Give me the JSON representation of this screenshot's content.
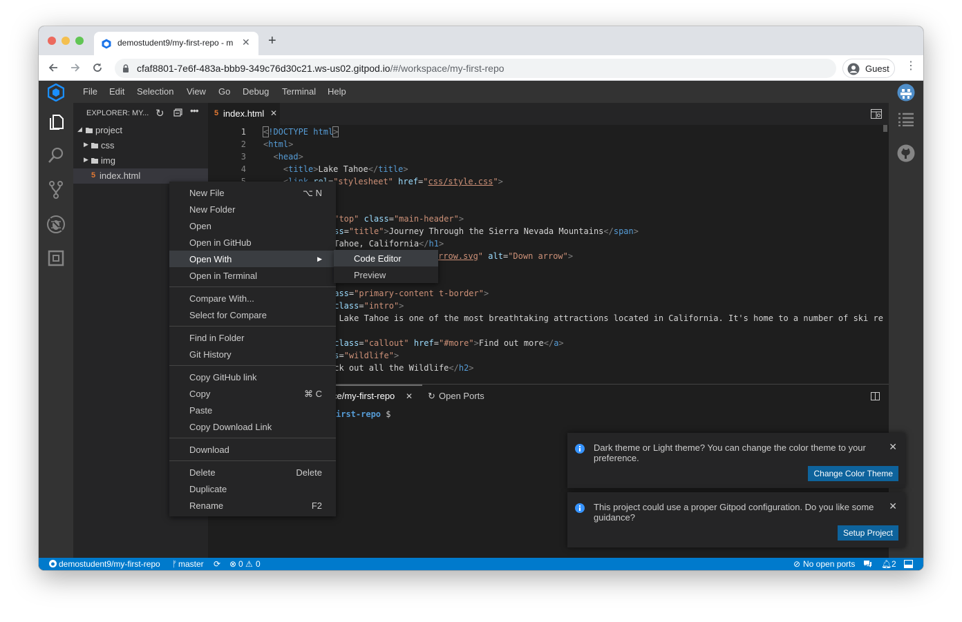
{
  "browser": {
    "tab_title": "demostudent9/my-first-repo - m",
    "url_main": "cfaf8801-7e6f-483a-bbb9-349c76d30c21.ws-us02.gitpod.io",
    "url_path": "/#/workspace/my-first-repo",
    "guest_label": "Guest"
  },
  "menubar": {
    "items": [
      "File",
      "Edit",
      "Selection",
      "View",
      "Go",
      "Debug",
      "Terminal",
      "Help"
    ]
  },
  "explorer": {
    "title": "EXPLORER: MY...",
    "tree": [
      {
        "label": "project",
        "type": "folder-open"
      },
      {
        "label": "css",
        "type": "folder"
      },
      {
        "label": "img",
        "type": "folder"
      },
      {
        "label": "index.html",
        "type": "file"
      }
    ]
  },
  "editor": {
    "tab_label": "index.html",
    "line_numbers": [
      "1",
      "2",
      "3",
      "4",
      "5"
    ]
  },
  "context_menu": {
    "groups": [
      [
        {
          "label": "New File",
          "shortcut": "⌥ N"
        },
        {
          "label": "New Folder",
          "shortcut": ""
        },
        {
          "label": "Open",
          "shortcut": ""
        },
        {
          "label": "Open in GitHub",
          "shortcut": ""
        },
        {
          "label": "Open With",
          "shortcut": ""
        },
        {
          "label": "Open in Terminal",
          "shortcut": ""
        }
      ],
      [
        {
          "label": "Compare With...",
          "shortcut": ""
        },
        {
          "label": "Select for Compare",
          "shortcut": ""
        }
      ],
      [
        {
          "label": "Find in Folder",
          "shortcut": ""
        },
        {
          "label": "Git History",
          "shortcut": ""
        }
      ],
      [
        {
          "label": "Copy GitHub link",
          "shortcut": ""
        },
        {
          "label": "Copy",
          "shortcut": "⌘ C"
        },
        {
          "label": "Paste",
          "shortcut": ""
        },
        {
          "label": "Copy Download Link",
          "shortcut": ""
        }
      ],
      [
        {
          "label": "Download",
          "shortcut": ""
        }
      ],
      [
        {
          "label": "Delete",
          "shortcut": "Delete"
        },
        {
          "label": "Duplicate",
          "shortcut": ""
        },
        {
          "label": "Rename",
          "shortcut": "F2"
        }
      ]
    ],
    "submenu": [
      "Code Editor",
      "Preview"
    ]
  },
  "panel": {
    "terminal_tab": "ce/my-first-repo",
    "ports_tab": "Open Ports",
    "prompt": "irst-repo",
    "prompt_symbol": "$"
  },
  "notifications": [
    {
      "message": "Dark theme or Light theme? You can change the color theme to your preference.",
      "button": "Change Color Theme"
    },
    {
      "message": "This project could use a proper Gitpod configuration. Do you like some guidance?",
      "button": "Setup Project"
    }
  ],
  "statusbar": {
    "repo": "demostudent9/my-first-repo",
    "branch": "master",
    "errors": "0",
    "warnings": "0",
    "ports": "No open ports",
    "bell_count": "2"
  },
  "colors": {
    "status_bar": "#007acc",
    "button": "#0e639c",
    "tag": "#569cd6",
    "attr": "#9cdcfe",
    "string": "#ce9178"
  }
}
